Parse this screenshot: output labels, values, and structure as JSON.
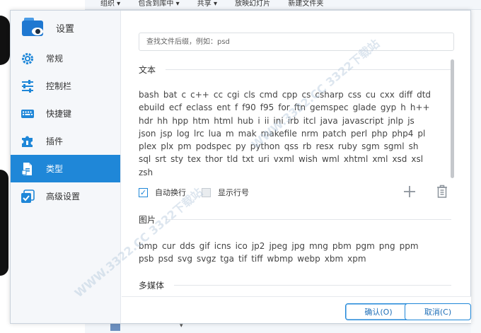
{
  "background_window": {
    "toolbar_items": [
      "组织 ▾",
      "包含到库中 ▾",
      "共享 ▾",
      "放映幻灯片",
      "新建文件夹"
    ],
    "scroll_arrow": "▾"
  },
  "dialog": {
    "app_title": "设置",
    "nav": [
      {
        "label": "常规",
        "icon": "gear-icon",
        "active": false
      },
      {
        "label": "控制栏",
        "icon": "sliders-icon",
        "active": false
      },
      {
        "label": "快捷键",
        "icon": "keyboard-icon",
        "active": false
      },
      {
        "label": "插件",
        "icon": "puzzle-icon",
        "active": false
      },
      {
        "label": "类型",
        "icon": "file-type-icon",
        "active": true
      },
      {
        "label": "高级设置",
        "icon": "advanced-checkbox-icon",
        "active": false
      }
    ],
    "search": {
      "placeholder": "查找文件后缀，例如：psd",
      "value": ""
    },
    "sections": {
      "text": {
        "title": "文本",
        "extensions": [
          "bash",
          "bat",
          "c",
          "c++",
          "cc",
          "cgi",
          "cls",
          "cmd",
          "cpp",
          "cs",
          "csharp",
          "css",
          "cu",
          "cxx",
          "diff",
          "dtd",
          "ebuild",
          "ecf",
          "eclass",
          "ent",
          "f",
          "f90",
          "f95",
          "for",
          "ftn",
          "gemspec",
          "glade",
          "gyp",
          "h",
          "h++",
          "hdr",
          "hh",
          "hpp",
          "htm",
          "html",
          "hub",
          "i",
          "ii",
          "ini",
          "irb",
          "itcl",
          "java",
          "javascript",
          "jnlp",
          "js",
          "json",
          "jsp",
          "log",
          "lrc",
          "lua",
          "m",
          "mak",
          "makefile",
          "nrm",
          "patch",
          "perl",
          "php",
          "php4",
          "pl",
          "plex",
          "plx",
          "pm",
          "podspec",
          "py",
          "python",
          "qss",
          "rb",
          "resx",
          "ruby",
          "sgm",
          "sgml",
          "sh",
          "sql",
          "srt",
          "sty",
          "tex",
          "thor",
          "tld",
          "txt",
          "uri",
          "vxml",
          "wish",
          "wml",
          "xhtml",
          "xml",
          "xsd",
          "xsl",
          "zsh"
        ]
      },
      "image": {
        "title": "图片",
        "extensions": [
          "bmp",
          "cur",
          "dds",
          "gif",
          "icns",
          "ico",
          "jp2",
          "jpeg",
          "jpg",
          "mng",
          "pbm",
          "pgm",
          "png",
          "ppm",
          "psb",
          "psd",
          "svg",
          "svgz",
          "tga",
          "tif",
          "tiff",
          "wbmp",
          "webp",
          "xbm",
          "xpm"
        ]
      },
      "media": {
        "title": "多媒体"
      }
    },
    "options": {
      "word_wrap": {
        "label": "自动换行",
        "checked": true
      },
      "line_numbers": {
        "label": "显示行号",
        "checked": false
      }
    },
    "buttons": {
      "ok": "确认(O)",
      "cancel": "取消(C)"
    }
  },
  "watermark": "WWW.3322.CC  3322下载站",
  "colors": {
    "accent": "#1f87d8",
    "sidebar_bg": "#f5f7fa"
  }
}
